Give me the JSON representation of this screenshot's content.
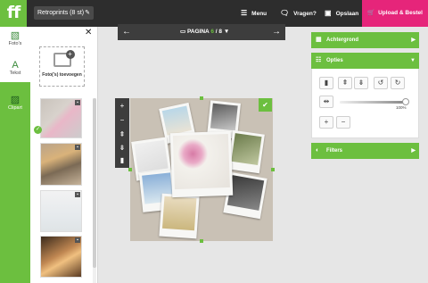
{
  "app": {
    "logo": "ff"
  },
  "header": {
    "title": "Retroprints (8 st)",
    "menu_label": "Menu",
    "help_label": "Vragen?",
    "save_label": "Opslaan",
    "upload_label": "Upload & Bestel"
  },
  "rail": {
    "items": [
      {
        "label": "Foto's",
        "icon": "photos-icon"
      },
      {
        "label": "Tekst",
        "icon": "text-icon"
      },
      {
        "label": "Clipart",
        "icon": "clipart-icon"
      }
    ]
  },
  "panel": {
    "add_photos_label": "Foto('s) toevoegen"
  },
  "pagebar": {
    "label": "PAGINA",
    "current": "6",
    "total": "/ 8"
  },
  "right": {
    "background_label": "Achtergrond",
    "options_label": "Opties",
    "filters_label": "Filters",
    "zoom_value": "100%"
  },
  "colors": {
    "accent": "#6cbf3f",
    "brand": "#e6257a",
    "dark": "#2d2d2d"
  }
}
